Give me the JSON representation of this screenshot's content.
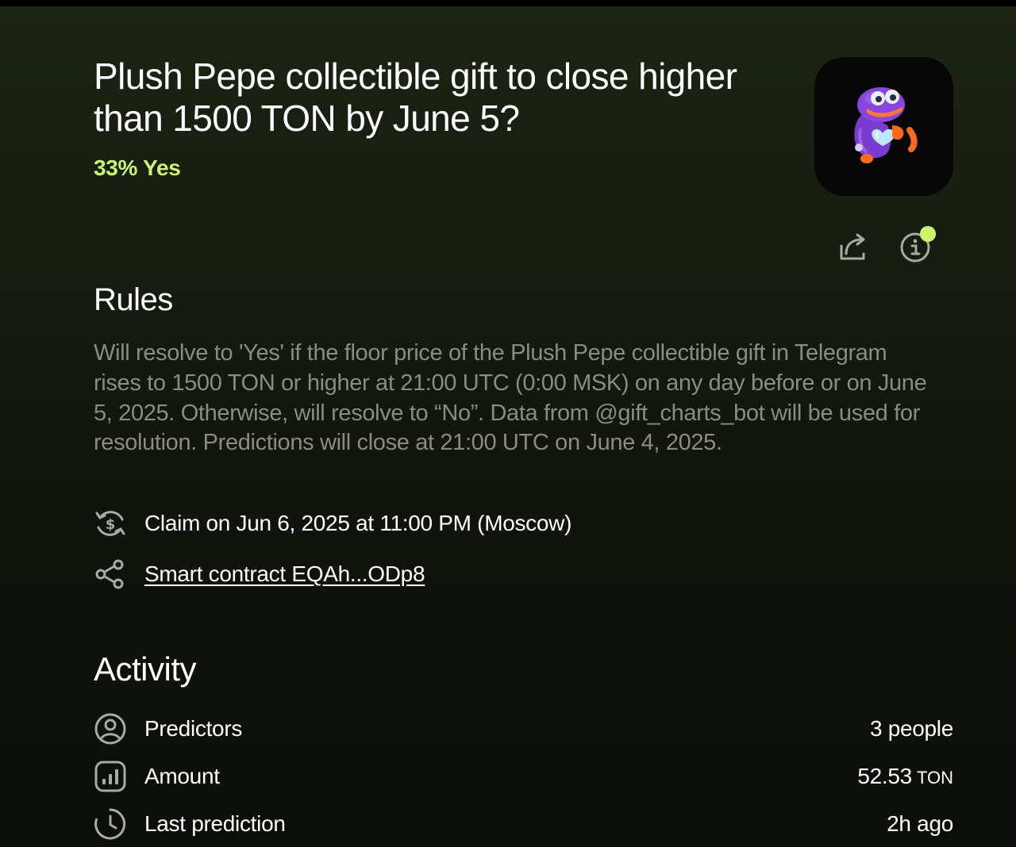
{
  "market": {
    "title": "Plush Pepe collectible gift to close higher than 1500 TON by June 5?",
    "odds": "33% Yes"
  },
  "icons": {
    "share": "share-icon",
    "info": "info-icon",
    "claim": "claim-dollar-cycle-icon",
    "contract": "share-nodes-icon",
    "predictors": "user-circle-icon",
    "amount": "bar-chart-icon",
    "last_prediction": "clock-icon"
  },
  "colors": {
    "accent": "#cbf56a",
    "muted_text": "#8b8b85",
    "background": "#10140c"
  },
  "rules": {
    "heading": "Rules",
    "text": "Will resolve to 'Yes' if the floor price of the Plush Pepe collectible gift in Telegram rises to 1500 TON or higher at 21:00 UTC (0:00 MSK) on any day before or on June 5, 2025. Otherwise, will resolve to “No”. Data from @gift_charts_bot will be used for resolution. Predictions will close at 21:00 UTC on June 4, 2025.",
    "claim": "Claim on Jun 6, 2025 at 11:00 PM (Moscow)",
    "contract_link": "Smart contract EQAh...ODp8"
  },
  "activity": {
    "heading": "Activity",
    "predictors": {
      "label": "Predictors",
      "value": "3 people"
    },
    "amount": {
      "label": "Amount",
      "value": "52.53",
      "unit": "TON"
    },
    "last_prediction": {
      "label": "Last prediction",
      "value": "2h ago"
    }
  }
}
